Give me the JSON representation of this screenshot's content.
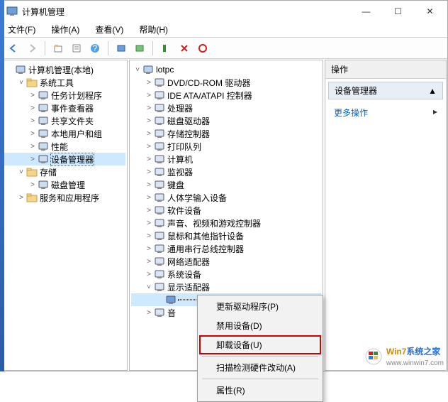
{
  "title": "计算机管理",
  "window_controls": {
    "min": "—",
    "max": "☐",
    "close": "✕"
  },
  "menu": [
    "文件(F)",
    "操作(A)",
    "查看(V)",
    "帮助(H)"
  ],
  "left_tree": {
    "root": "计算机管理(本地)",
    "groups": [
      {
        "label": "系统工具",
        "exp": "˅",
        "children": [
          "任务计划程序",
          "事件查看器",
          "共享文件夹",
          "本地用户和组",
          "性能",
          "设备管理器"
        ],
        "sel_index": 5
      },
      {
        "label": "存储",
        "exp": "˅",
        "children": [
          "磁盘管理"
        ]
      },
      {
        "label": "服务和应用程序",
        "exp": "˃",
        "children": []
      }
    ]
  },
  "mid_tree": {
    "root": "lotpc",
    "items": [
      {
        "l": "DVD/CD-ROM 驱动器",
        "e": "˃"
      },
      {
        "l": "IDE ATA/ATAPI 控制器",
        "e": "˃"
      },
      {
        "l": "处理器",
        "e": "˃"
      },
      {
        "l": "磁盘驱动器",
        "e": "˃"
      },
      {
        "l": "存储控制器",
        "e": "˃"
      },
      {
        "l": "打印队列",
        "e": "˃"
      },
      {
        "l": "计算机",
        "e": "˃"
      },
      {
        "l": "监视器",
        "e": "˃"
      },
      {
        "l": "键盘",
        "e": "˃"
      },
      {
        "l": "人体学输入设备",
        "e": "˃"
      },
      {
        "l": "软件设备",
        "e": "˃"
      },
      {
        "l": "声音、视频和游戏控制器",
        "e": "˃"
      },
      {
        "l": "鼠标和其他指针设备",
        "e": "˃"
      },
      {
        "l": "通用串行总线控制器",
        "e": "˃"
      },
      {
        "l": "网络适配器",
        "e": "˃"
      },
      {
        "l": "系统设备",
        "e": "˃"
      },
      {
        "l": "显示适配器",
        "e": "˅",
        "open": true,
        "child": " "
      },
      {
        "l": "音",
        "e": "˃"
      }
    ]
  },
  "right_panel": {
    "header": "操作",
    "accordion": "设备管理器",
    "link": "更多操作",
    "arrow": "▸"
  },
  "context_menu": [
    {
      "l": "更新驱动程序(P)"
    },
    {
      "l": "禁用设备(D)"
    },
    {
      "l": "卸载设备(U)",
      "hl": true
    },
    {
      "sep": true
    },
    {
      "l": "扫描检测硬件改动(A)"
    },
    {
      "sep": true
    },
    {
      "l": "属性(R)"
    }
  ],
  "watermark": {
    "brand1": "Win7",
    "brand2": "系统之家",
    "url": "www.winwin7.com"
  }
}
